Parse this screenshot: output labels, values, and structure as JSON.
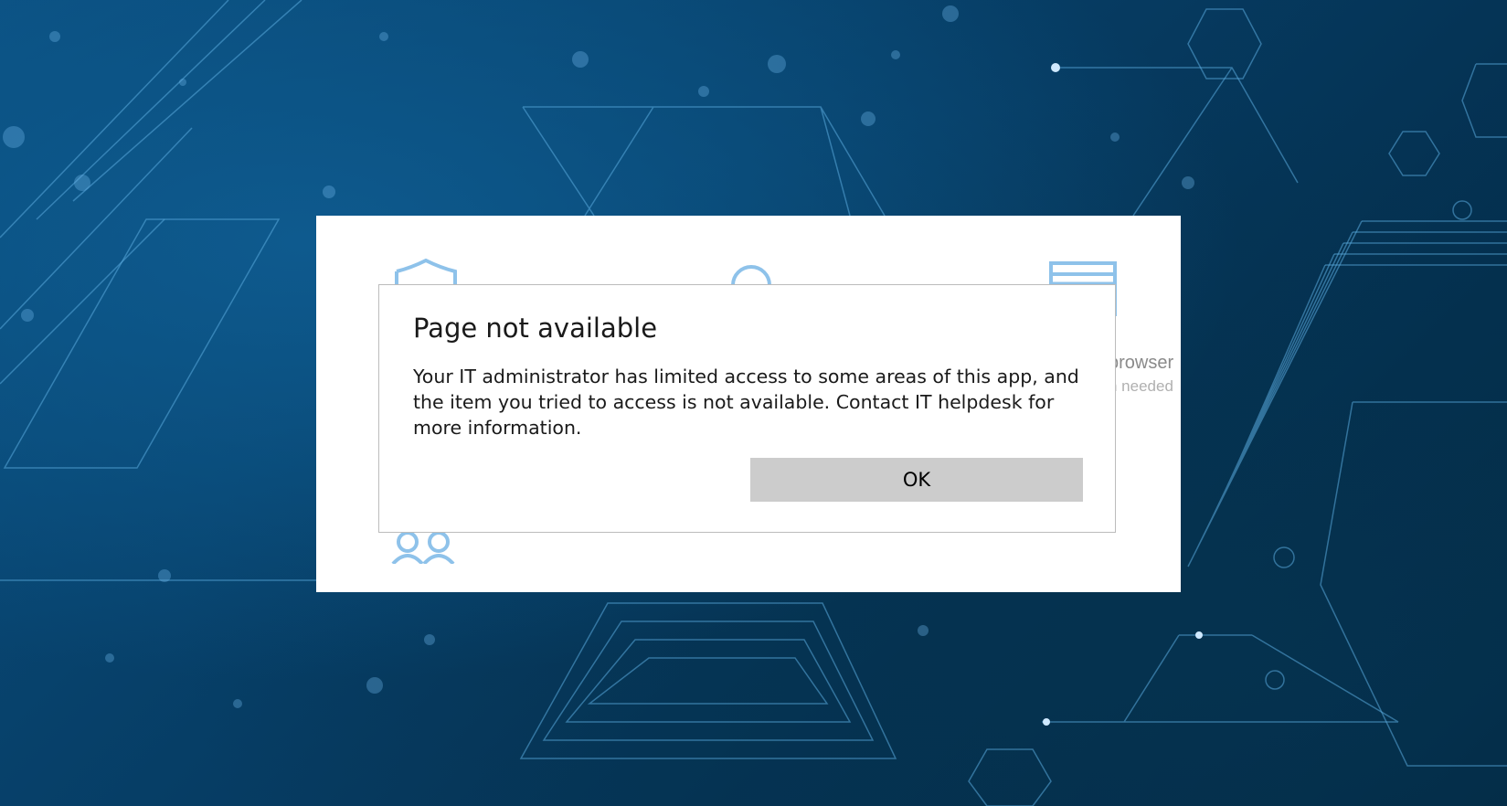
{
  "background_app": {
    "icons": [
      "shield-icon",
      "person-icon",
      "browser-icon",
      "family-icon"
    ],
    "tile_text_line1": "browser",
    "tile_text_line2": "n needed"
  },
  "dialog": {
    "title": "Page not available",
    "message": "Your IT administrator has limited access to some areas of this app, and the item you tried to access is not available. Contact IT helpdesk for more information.",
    "ok_label": "OK"
  },
  "colors": {
    "icon_blue": "#8ec2ea",
    "button_gray": "#cccccc",
    "wallpaper_dark": "#03263f",
    "wallpaper_mid": "#0a4f80"
  }
}
